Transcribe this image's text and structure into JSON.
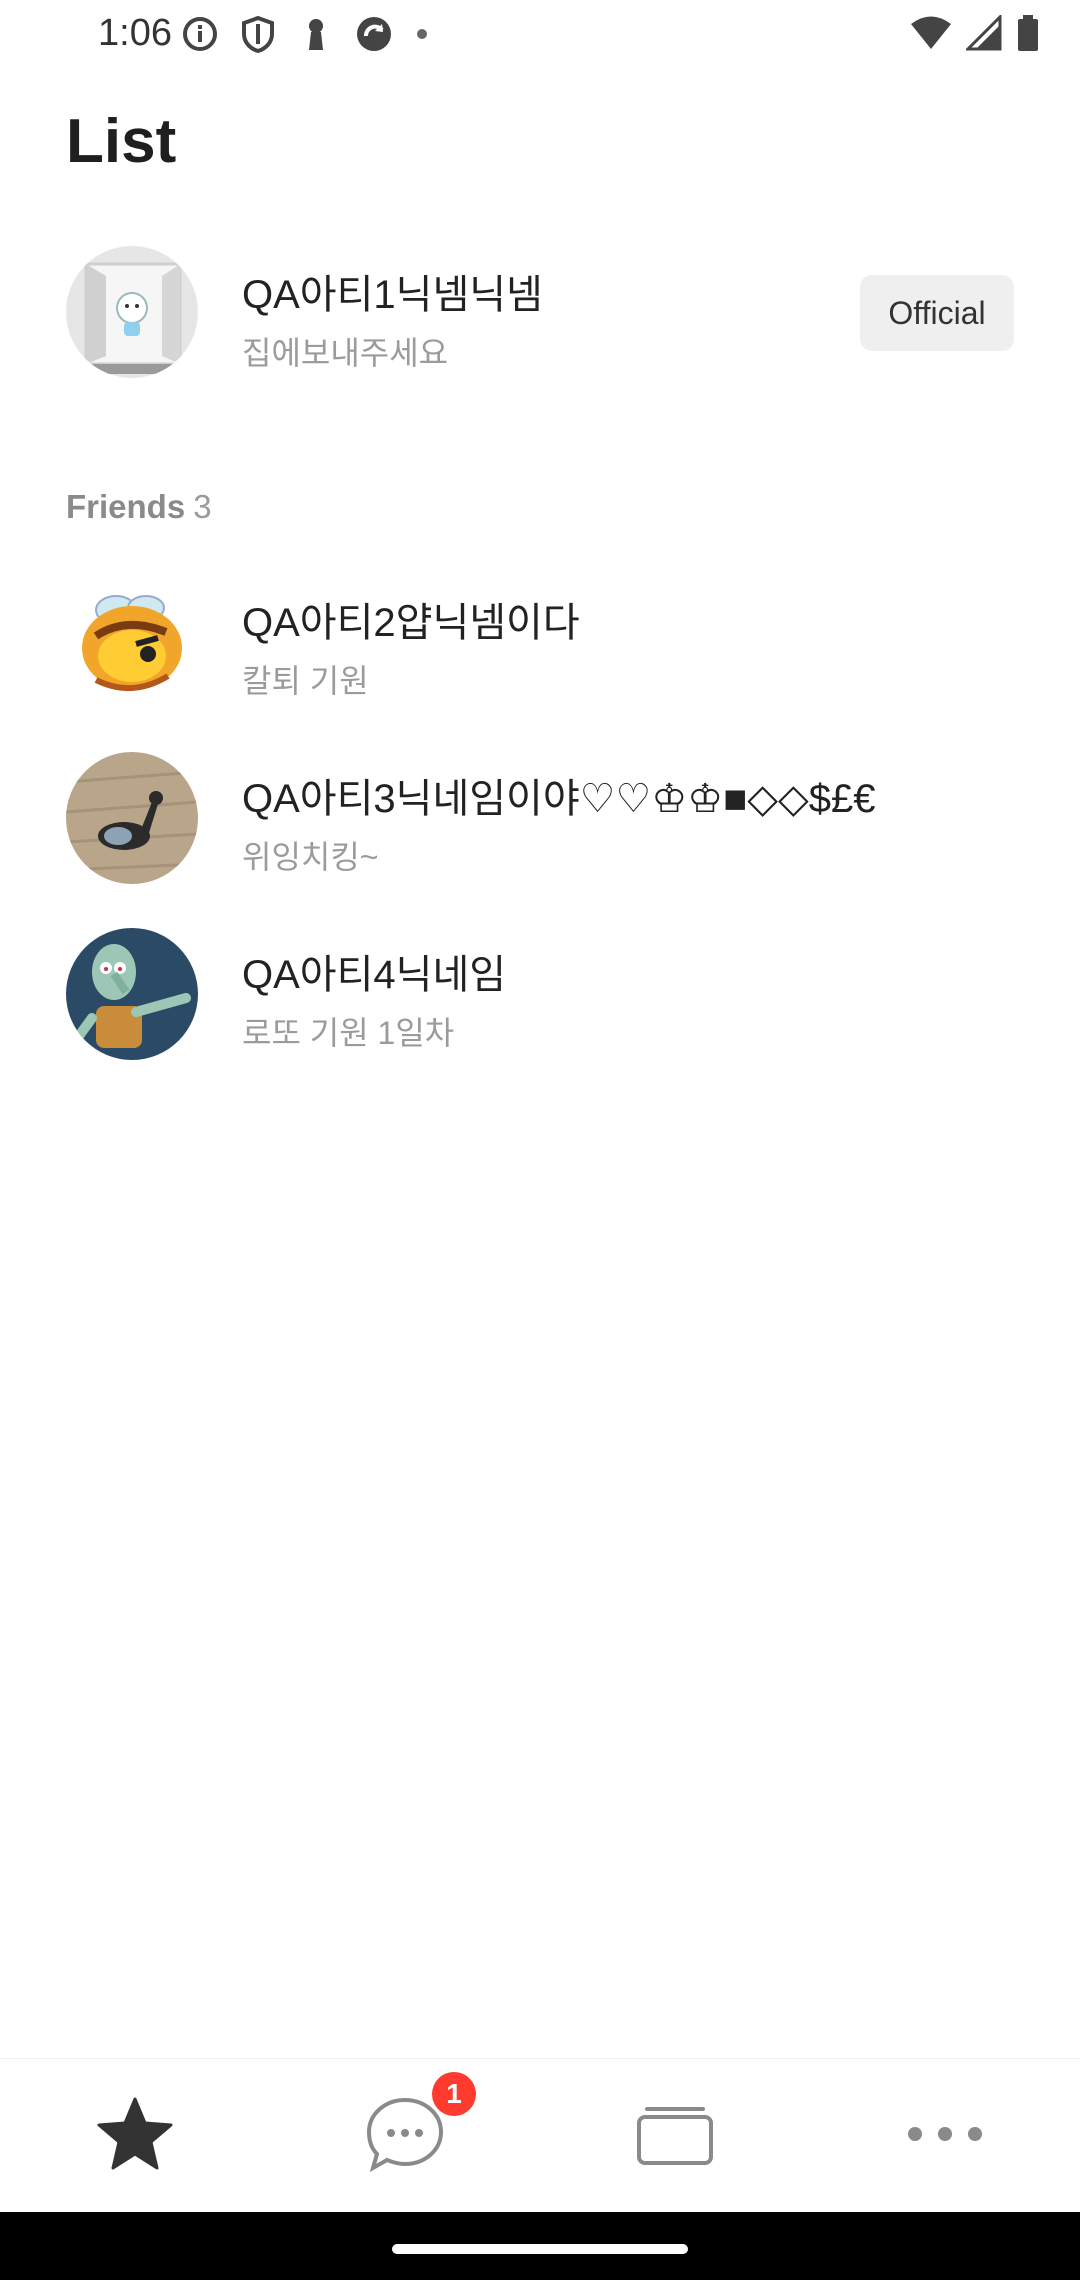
{
  "status_bar": {
    "time": "1:06",
    "left_icons": [
      "info-icon",
      "shield-icon",
      "keyhole-icon",
      "sync-app-icon",
      "dot-icon"
    ],
    "right_icons": [
      "wifi-icon",
      "signal-icon",
      "battery-icon"
    ]
  },
  "header": {
    "title": "List"
  },
  "official": {
    "name": "QA아티1닉넴닉넴",
    "status": "집에보내주세요",
    "badge": "Official"
  },
  "friends_section": {
    "title": "Friends",
    "count": "3"
  },
  "friends": [
    {
      "name": "QA아티2얍닉넴이다",
      "status": "칼퇴 기원"
    },
    {
      "name": "QA아티3닉네임이야♡♡♔♔■◇◇$£€",
      "status": "위잉치킹~"
    },
    {
      "name": "QA아티4닉네임",
      "status": "로또 기원 1일차"
    }
  ],
  "bottom_nav": {
    "items": [
      "star-icon",
      "chat-icon",
      "feed-icon",
      "more-icon"
    ],
    "chat_badge": "1"
  }
}
